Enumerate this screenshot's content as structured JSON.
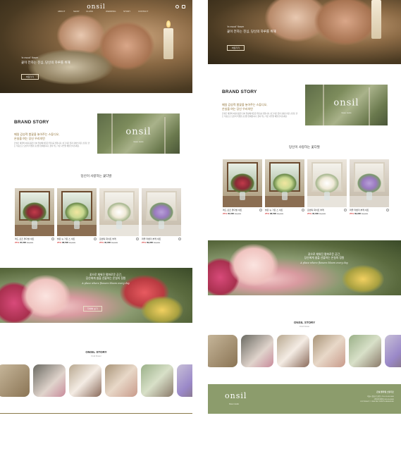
{
  "brand": {
    "logo": "onsil",
    "tagline": "flower studio"
  },
  "nav": {
    "menu": [
      "ABOUT",
      "SHOP",
      "CLASS",
      "WEDDING",
      "STORY",
      "CONTACT"
    ]
  },
  "hero": {
    "subtitle": "‘in mood’ flower",
    "title": "꽃이 전하는 진심, 당신의 하루를 위해",
    "button": "바로가기"
  },
  "brand_story": {
    "title": "BRAND STORY",
    "headline_1": "매일 감성적 봄꽃을 놓아주는 스튜디오,",
    "headline_2": "온실을 여는 당신 우리의언",
    "body": "온실은 계절의 아름다움을 담아 일상에 따뜻한 위로를 전합니다. 싱그러운 꽃과 정성스러운 손길로 만든 작품으로 당신의 특별한 순간을 함께합니다. 꽃이 주는 작은 기쁘을 매일 만나보세요.",
    "image_logo": "onsil",
    "image_tag": "flower studio"
  },
  "products_section": {
    "title": "당신이 사랑하는 꽃다발",
    "items": [
      {
        "name": "레드 로즈 꽃다발 세트",
        "discount": "25%",
        "price": "45,000",
        "old_price": "60,000"
      },
      {
        "name": "밝은 뉴 가든 스 세트",
        "discount": "25%",
        "price": "38,500",
        "old_price": "52,000"
      },
      {
        "name": "로맨틱 화이트 부케",
        "discount": "25%",
        "price": "40,000",
        "old_price": "53,000"
      },
      {
        "name": "퍼플 라벤더 부케 세트",
        "discount": "25%",
        "price": "39,900",
        "old_price": "53,000"
      }
    ]
  },
  "garden": {
    "line1": "꽃으로 채워진 평화로운 공간,",
    "line2": "당신에게 쉼을 선물하는 온실의 정원",
    "script": "A place where flowers bloom every day",
    "button": "자세히 보기"
  },
  "story": {
    "title": "ONSIL STORY",
    "subtitle": "Onsil Flower"
  },
  "footer": {
    "logo": "onsil",
    "tag": "flower studio",
    "head": "온실 플라워 스튜디오",
    "info_1": "서울시 강남구 논현동 | TEL 02-000-0000",
    "info_2": "사업자등록번호 000-00-00000",
    "info_3": "COPYRIGHT © ONSIL ALL RIGHTS RESERVED"
  },
  "colors": {
    "accent_gold": "#8a6a2b",
    "sale_red": "#d23a3a",
    "footer_green": "#8c9c6c"
  }
}
